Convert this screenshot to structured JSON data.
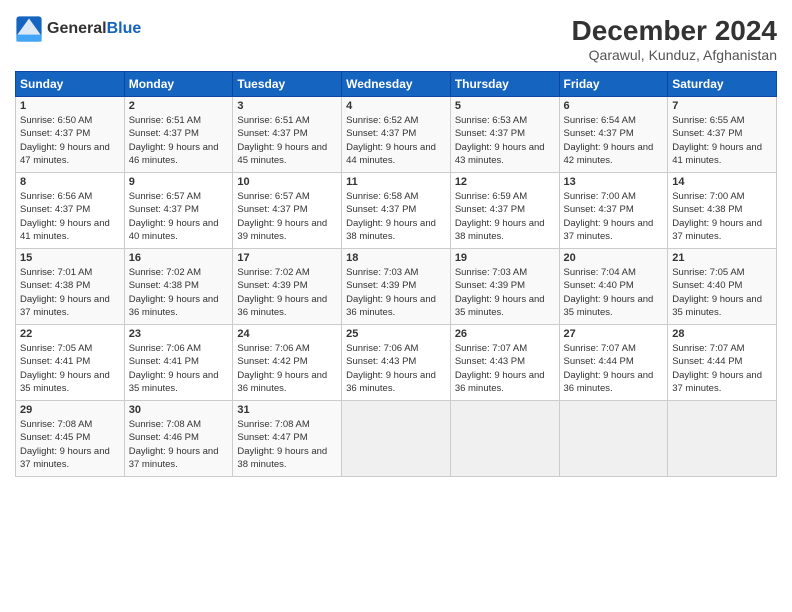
{
  "header": {
    "logo_general": "General",
    "logo_blue": "Blue",
    "month_year": "December 2024",
    "location": "Qarawul, Kunduz, Afghanistan"
  },
  "days_of_week": [
    "Sunday",
    "Monday",
    "Tuesday",
    "Wednesday",
    "Thursday",
    "Friday",
    "Saturday"
  ],
  "weeks": [
    [
      {
        "day": "1",
        "sunrise": "6:50 AM",
        "sunset": "4:37 PM",
        "daylight": "9 hours and 47 minutes."
      },
      {
        "day": "2",
        "sunrise": "6:51 AM",
        "sunset": "4:37 PM",
        "daylight": "9 hours and 46 minutes."
      },
      {
        "day": "3",
        "sunrise": "6:51 AM",
        "sunset": "4:37 PM",
        "daylight": "9 hours and 45 minutes."
      },
      {
        "day": "4",
        "sunrise": "6:52 AM",
        "sunset": "4:37 PM",
        "daylight": "9 hours and 44 minutes."
      },
      {
        "day": "5",
        "sunrise": "6:53 AM",
        "sunset": "4:37 PM",
        "daylight": "9 hours and 43 minutes."
      },
      {
        "day": "6",
        "sunrise": "6:54 AM",
        "sunset": "4:37 PM",
        "daylight": "9 hours and 42 minutes."
      },
      {
        "day": "7",
        "sunrise": "6:55 AM",
        "sunset": "4:37 PM",
        "daylight": "9 hours and 41 minutes."
      }
    ],
    [
      {
        "day": "8",
        "sunrise": "6:56 AM",
        "sunset": "4:37 PM",
        "daylight": "9 hours and 41 minutes."
      },
      {
        "day": "9",
        "sunrise": "6:57 AM",
        "sunset": "4:37 PM",
        "daylight": "9 hours and 40 minutes."
      },
      {
        "day": "10",
        "sunrise": "6:57 AM",
        "sunset": "4:37 PM",
        "daylight": "9 hours and 39 minutes."
      },
      {
        "day": "11",
        "sunrise": "6:58 AM",
        "sunset": "4:37 PM",
        "daylight": "9 hours and 38 minutes."
      },
      {
        "day": "12",
        "sunrise": "6:59 AM",
        "sunset": "4:37 PM",
        "daylight": "9 hours and 38 minutes."
      },
      {
        "day": "13",
        "sunrise": "7:00 AM",
        "sunset": "4:37 PM",
        "daylight": "9 hours and 37 minutes."
      },
      {
        "day": "14",
        "sunrise": "7:00 AM",
        "sunset": "4:38 PM",
        "daylight": "9 hours and 37 minutes."
      }
    ],
    [
      {
        "day": "15",
        "sunrise": "7:01 AM",
        "sunset": "4:38 PM",
        "daylight": "9 hours and 37 minutes."
      },
      {
        "day": "16",
        "sunrise": "7:02 AM",
        "sunset": "4:38 PM",
        "daylight": "9 hours and 36 minutes."
      },
      {
        "day": "17",
        "sunrise": "7:02 AM",
        "sunset": "4:39 PM",
        "daylight": "9 hours and 36 minutes."
      },
      {
        "day": "18",
        "sunrise": "7:03 AM",
        "sunset": "4:39 PM",
        "daylight": "9 hours and 36 minutes."
      },
      {
        "day": "19",
        "sunrise": "7:03 AM",
        "sunset": "4:39 PM",
        "daylight": "9 hours and 35 minutes."
      },
      {
        "day": "20",
        "sunrise": "7:04 AM",
        "sunset": "4:40 PM",
        "daylight": "9 hours and 35 minutes."
      },
      {
        "day": "21",
        "sunrise": "7:05 AM",
        "sunset": "4:40 PM",
        "daylight": "9 hours and 35 minutes."
      }
    ],
    [
      {
        "day": "22",
        "sunrise": "7:05 AM",
        "sunset": "4:41 PM",
        "daylight": "9 hours and 35 minutes."
      },
      {
        "day": "23",
        "sunrise": "7:06 AM",
        "sunset": "4:41 PM",
        "daylight": "9 hours and 35 minutes."
      },
      {
        "day": "24",
        "sunrise": "7:06 AM",
        "sunset": "4:42 PM",
        "daylight": "9 hours and 36 minutes."
      },
      {
        "day": "25",
        "sunrise": "7:06 AM",
        "sunset": "4:43 PM",
        "daylight": "9 hours and 36 minutes."
      },
      {
        "day": "26",
        "sunrise": "7:07 AM",
        "sunset": "4:43 PM",
        "daylight": "9 hours and 36 minutes."
      },
      {
        "day": "27",
        "sunrise": "7:07 AM",
        "sunset": "4:44 PM",
        "daylight": "9 hours and 36 minutes."
      },
      {
        "day": "28",
        "sunrise": "7:07 AM",
        "sunset": "4:44 PM",
        "daylight": "9 hours and 37 minutes."
      }
    ],
    [
      {
        "day": "29",
        "sunrise": "7:08 AM",
        "sunset": "4:45 PM",
        "daylight": "9 hours and 37 minutes."
      },
      {
        "day": "30",
        "sunrise": "7:08 AM",
        "sunset": "4:46 PM",
        "daylight": "9 hours and 37 minutes."
      },
      {
        "day": "31",
        "sunrise": "7:08 AM",
        "sunset": "4:47 PM",
        "daylight": "9 hours and 38 minutes."
      },
      null,
      null,
      null,
      null
    ]
  ]
}
